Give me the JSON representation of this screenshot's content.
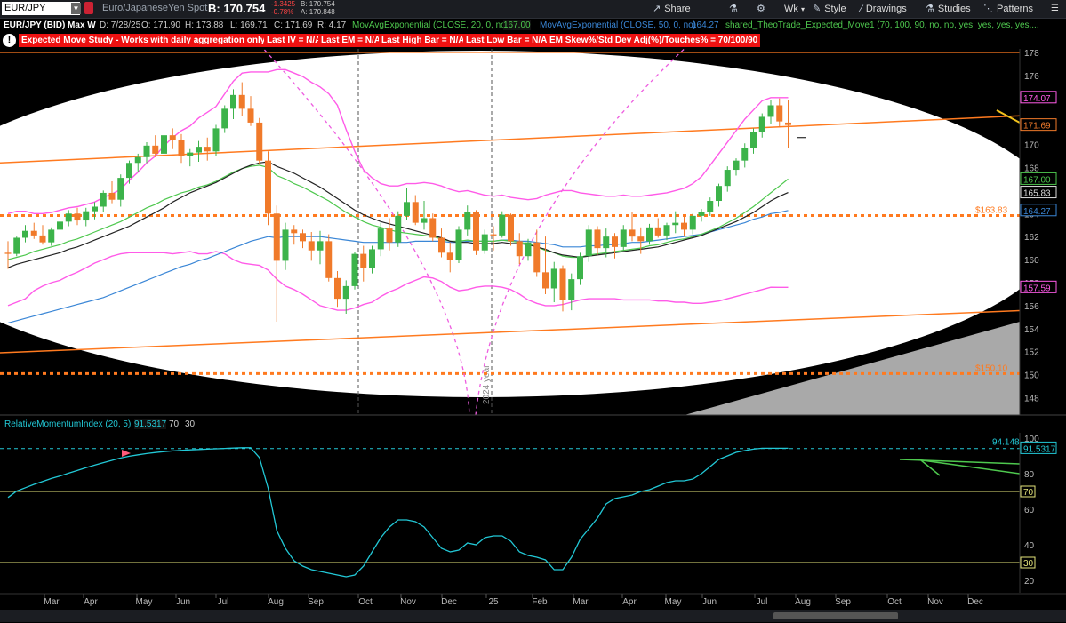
{
  "toolbar": {
    "symbol": "EUR/JPY",
    "description": "Euro/JapaneseYen Spot",
    "bid": "B: 170.754",
    "change": "-1.3425",
    "change_pct": "-0.78%",
    "bid_small": "B: 170.754",
    "ask_small": "A: 170.848",
    "share": "Share",
    "timeframe": "Wk",
    "style": "Style",
    "drawings": "Drawings",
    "studies": "Studies",
    "patterns": "Patterns"
  },
  "legend": {
    "title": "EUR/JPY (BID) Max W",
    "date": "D: 7/28/25",
    "open": "O: 171.90",
    "high": "H: 173.88",
    "low": "L: 169.71",
    "close": "C: 171.69",
    "range": "R: 4.17",
    "ema20": "MovAvgExponential (CLOSE, 20, 0, no)",
    "ema20_val": "167.00",
    "ema50": "MovAvgExponential (CLOSE, 50, 0, no)",
    "ema50_val": "164.27",
    "study": "shared_TheoTrade_Expected_Move1 (70, 100, 90, no, no, yes, yes, yes, yes,..."
  },
  "alerts": [
    "Expected Move Study - Works with daily aggregation only.",
    "Last IV = N/A",
    "Last EM = N/A",
    "Last High Bar = N/A",
    "Last Low Bar = N/A",
    "EM Skew%/Std Dev Adj(%)/Touches% = 70/100/90"
  ],
  "lower": {
    "title": "RelativeMomentumIndex (20, 5)",
    "value": "91.5317",
    "ob": "70",
    "os": "30",
    "max_label": "94.148"
  },
  "annotations": {
    "level_high": "$163.83",
    "level_low": "$150.10",
    "year_label": "2024 year"
  },
  "colors": {
    "bull": "#3cb34a",
    "bear": "#f07a2a",
    "bollinger": "#ff5be8",
    "ema20": "#4ec84e",
    "ema50": "#3a86d6",
    "sma": "#222222",
    "channel": "#ff7a1f",
    "rmi": "#22c8d6"
  },
  "chart_data": [
    {
      "type": "candlestick",
      "title": "EUR/JPY (BID) Max W",
      "ylim": [
        146.5,
        178.3
      ],
      "yticks": [
        148,
        150,
        152,
        154,
        156,
        158,
        160,
        162,
        164,
        166,
        168,
        170,
        172,
        174,
        176,
        178
      ],
      "months": [
        "Mar",
        "Apr",
        "May",
        "Jun",
        "Jul",
        "Aug",
        "Sep",
        "Oct",
        "Nov",
        "Dec",
        "25",
        "Feb",
        "Mar",
        "Apr",
        "May",
        "Jun",
        "Jul",
        "Aug",
        "Sep",
        "Oct",
        "Nov",
        "Dec"
      ],
      "price_labels": [
        {
          "text": "174.07",
          "value": 174.07,
          "color": "#ff5be8"
        },
        {
          "text": "171.69",
          "value": 171.69,
          "color": "#f07a2a"
        },
        {
          "text": "167.00",
          "value": 167.0,
          "color": "#4ec84e"
        },
        {
          "text": "165.83",
          "value": 165.83,
          "color": "#dddddd"
        },
        {
          "text": "164.27",
          "value": 164.27,
          "color": "#3a86d6"
        },
        {
          "text": "157.59",
          "value": 157.59,
          "color": "#ff5be8"
        }
      ],
      "levels": [
        163.83,
        150.1,
        178.0
      ],
      "candles": [
        [
          160.6,
          161.6,
          159.2,
          160.5
        ],
        [
          160.5,
          162.0,
          160.3,
          161.9
        ],
        [
          161.9,
          163.0,
          161.5,
          162.5
        ],
        [
          162.5,
          163.2,
          161.8,
          162.1
        ],
        [
          162.1,
          163.0,
          161.3,
          161.5
        ],
        [
          161.5,
          162.8,
          161.2,
          162.6
        ],
        [
          162.6,
          163.6,
          162.2,
          163.3
        ],
        [
          163.3,
          164.3,
          162.9,
          164.0
        ],
        [
          164.0,
          164.5,
          163.0,
          163.4
        ],
        [
          163.4,
          164.5,
          162.9,
          164.2
        ],
        [
          164.2,
          165.0,
          163.5,
          164.6
        ],
        [
          164.6,
          166.0,
          164.1,
          165.8
        ],
        [
          165.8,
          166.8,
          164.9,
          165.2
        ],
        [
          165.2,
          167.4,
          164.6,
          167.1
        ],
        [
          167.1,
          168.6,
          166.6,
          168.4
        ],
        [
          168.4,
          169.2,
          167.6,
          168.9
        ],
        [
          168.9,
          170.2,
          168.4,
          169.9
        ],
        [
          169.9,
          170.8,
          168.9,
          169.2
        ],
        [
          169.2,
          171.1,
          168.8,
          170.8
        ],
        [
          170.8,
          171.4,
          169.6,
          170.4
        ],
        [
          170.4,
          170.9,
          168.4,
          169.0
        ],
        [
          169.0,
          169.6,
          168.1,
          169.3
        ],
        [
          169.3,
          170.3,
          168.5,
          169.8
        ],
        [
          169.8,
          170.6,
          168.6,
          169.4
        ],
        [
          169.4,
          171.7,
          169.0,
          171.4
        ],
        [
          171.4,
          173.4,
          171.0,
          173.1
        ],
        [
          173.1,
          174.8,
          172.2,
          174.3
        ],
        [
          174.3,
          175.4,
          172.5,
          173.1
        ],
        [
          173.1,
          174.2,
          171.6,
          171.9
        ],
        [
          171.9,
          172.3,
          168.3,
          168.6
        ],
        [
          168.6,
          169.4,
          163.0,
          164.0
        ],
        [
          164.0,
          164.7,
          154.6,
          159.9
        ],
        [
          159.9,
          163.2,
          159.1,
          162.6
        ],
        [
          162.6,
          163.0,
          161.3,
          162.3
        ],
        [
          162.3,
          162.6,
          161.0,
          161.6
        ],
        [
          161.6,
          162.4,
          159.9,
          160.8
        ],
        [
          160.8,
          162.5,
          159.6,
          161.6
        ],
        [
          161.6,
          162.2,
          158.1,
          158.4
        ],
        [
          158.4,
          159.0,
          155.9,
          156.6
        ],
        [
          156.6,
          158.2,
          155.3,
          157.7
        ],
        [
          157.7,
          160.7,
          157.4,
          160.5
        ],
        [
          160.5,
          161.2,
          158.1,
          159.3
        ],
        [
          159.3,
          161.2,
          158.8,
          160.9
        ],
        [
          160.9,
          163.2,
          160.3,
          162.7
        ],
        [
          162.7,
          163.6,
          160.8,
          161.5
        ],
        [
          161.5,
          164.2,
          161.1,
          163.8
        ],
        [
          163.8,
          166.2,
          163.4,
          165.0
        ],
        [
          165.0,
          165.6,
          163.0,
          163.2
        ],
        [
          163.2,
          165.1,
          162.6,
          163.6
        ],
        [
          163.6,
          164.0,
          161.6,
          161.9
        ],
        [
          161.9,
          162.7,
          160.2,
          160.6
        ],
        [
          160.6,
          161.5,
          158.9,
          160.0
        ],
        [
          160.0,
          162.9,
          159.7,
          162.6
        ],
        [
          162.6,
          164.7,
          162.1,
          164.1
        ],
        [
          164.1,
          164.3,
          160.4,
          160.8
        ],
        [
          160.8,
          162.6,
          160.5,
          162.2
        ],
        [
          162.2,
          162.9,
          160.8,
          162.1
        ],
        [
          162.1,
          164.2,
          161.9,
          163.9
        ],
        [
          163.9,
          164.0,
          161.2,
          161.6
        ],
        [
          161.6,
          162.3,
          159.6,
          160.3
        ],
        [
          160.3,
          161.8,
          159.9,
          161.5
        ],
        [
          161.5,
          162.6,
          158.5,
          158.9
        ],
        [
          158.9,
          162.0,
          157.0,
          157.5
        ],
        [
          157.5,
          159.8,
          156.3,
          159.2
        ],
        [
          159.2,
          159.5,
          155.5,
          156.5
        ],
        [
          156.5,
          158.8,
          155.6,
          158.3
        ],
        [
          158.3,
          160.6,
          157.8,
          160.3
        ],
        [
          160.3,
          163.0,
          159.8,
          162.6
        ],
        [
          162.6,
          162.9,
          160.4,
          161.0
        ],
        [
          161.0,
          162.7,
          160.2,
          162.0
        ],
        [
          162.0,
          162.3,
          160.1,
          161.1
        ],
        [
          161.1,
          163.0,
          160.8,
          162.6
        ],
        [
          162.6,
          164.1,
          161.6,
          162.0
        ],
        [
          162.0,
          162.8,
          160.5,
          161.6
        ],
        [
          161.6,
          163.1,
          161.3,
          162.8
        ],
        [
          162.8,
          163.6,
          161.9,
          162.1
        ],
        [
          162.1,
          163.2,
          161.7,
          163.0
        ],
        [
          163.0,
          164.2,
          162.3,
          163.2
        ],
        [
          163.2,
          163.8,
          162.0,
          162.6
        ],
        [
          162.6,
          164.0,
          162.2,
          163.8
        ],
        [
          163.8,
          164.4,
          163.3,
          164.1
        ],
        [
          164.1,
          165.4,
          163.8,
          165.1
        ],
        [
          165.1,
          166.6,
          164.6,
          166.4
        ],
        [
          166.4,
          168.1,
          165.9,
          167.8
        ],
        [
          167.8,
          168.8,
          167.3,
          168.6
        ],
        [
          168.6,
          170.1,
          168.0,
          169.7
        ],
        [
          169.7,
          171.4,
          169.2,
          171.1
        ],
        [
          171.1,
          172.7,
          170.6,
          172.4
        ],
        [
          172.4,
          173.9,
          171.8,
          173.4
        ],
        [
          173.4,
          174.0,
          171.5,
          172.0
        ],
        [
          171.9,
          173.88,
          169.71,
          171.69
        ]
      ],
      "ema20": [
        160.0,
        160.2,
        160.4,
        160.7,
        160.9,
        161.1,
        161.3,
        161.6,
        161.8,
        162.1,
        162.4,
        162.7,
        163.0,
        163.3,
        163.7,
        164.1,
        164.5,
        164.8,
        165.2,
        165.5,
        165.8,
        166.0,
        166.3,
        166.5,
        166.8,
        167.2,
        167.6,
        167.9,
        168.1,
        168.2,
        168.0,
        167.3,
        167.0,
        166.6,
        166.3,
        165.9,
        165.5,
        165.1,
        164.6,
        164.1,
        163.7,
        163.3,
        163.0,
        162.8,
        162.6,
        162.4,
        162.3,
        162.2,
        162.1,
        162.0,
        161.8,
        161.6,
        161.6,
        161.7,
        161.6,
        161.6,
        161.6,
        161.7,
        161.6,
        161.5,
        161.4,
        161.1,
        160.8,
        160.6,
        160.3,
        160.2,
        160.2,
        160.4,
        160.5,
        160.6,
        160.7,
        160.8,
        160.9,
        161.0,
        161.2,
        161.3,
        161.5,
        161.7,
        161.8,
        162.0,
        162.2,
        162.5,
        162.8,
        163.2,
        163.6,
        164.1,
        164.6,
        165.2,
        165.8,
        166.4,
        167.0
      ],
      "ema50": [
        154.5,
        154.7,
        154.9,
        155.1,
        155.3,
        155.5,
        155.7,
        155.9,
        156.1,
        156.3,
        156.5,
        156.7,
        157.0,
        157.3,
        157.6,
        157.9,
        158.2,
        158.5,
        158.8,
        159.1,
        159.4,
        159.6,
        159.9,
        160.1,
        160.4,
        160.7,
        161.0,
        161.3,
        161.6,
        161.8,
        162.0,
        161.9,
        162.0,
        162.0,
        162.0,
        162.0,
        162.0,
        161.9,
        161.8,
        161.7,
        161.6,
        161.5,
        161.5,
        161.5,
        161.5,
        161.5,
        161.5,
        161.6,
        161.6,
        161.6,
        161.6,
        161.5,
        161.5,
        161.6,
        161.6,
        161.6,
        161.6,
        161.7,
        161.7,
        161.6,
        161.6,
        161.5,
        161.4,
        161.3,
        161.1,
        161.1,
        161.1,
        161.2,
        161.2,
        161.3,
        161.3,
        161.4,
        161.5,
        161.5,
        161.6,
        161.7,
        161.8,
        161.9,
        162.0,
        162.1,
        162.2,
        162.4,
        162.6,
        162.8,
        163.0,
        163.2,
        163.5,
        163.7,
        164.0,
        164.1,
        164.27
      ],
      "sma": [
        159.3,
        159.6,
        159.8,
        160.0,
        160.2,
        160.4,
        160.6,
        160.9,
        161.1,
        161.4,
        161.7,
        162.0,
        162.3,
        162.6,
        162.9,
        163.3,
        163.7,
        164.1,
        164.5,
        165.0,
        165.4,
        165.8,
        166.1,
        166.4,
        166.7,
        167.1,
        167.5,
        167.9,
        168.2,
        168.4,
        168.5,
        168.1,
        167.8,
        167.5,
        167.1,
        166.7,
        166.3,
        165.8,
        165.3,
        164.8,
        164.3,
        163.9,
        163.6,
        163.3,
        163.1,
        162.9,
        162.7,
        162.5,
        162.3,
        162.1,
        161.9,
        161.6,
        161.5,
        161.5,
        161.4,
        161.4,
        161.4,
        161.5,
        161.4,
        161.4,
        161.3,
        161.1,
        160.9,
        160.6,
        160.4,
        160.3,
        160.2,
        160.3,
        160.4,
        160.5,
        160.6,
        160.7,
        160.8,
        160.9,
        161.0,
        161.1,
        161.3,
        161.5,
        161.7,
        161.9,
        162.1,
        162.4,
        162.7,
        163.0,
        163.3,
        163.7,
        164.1,
        164.6,
        165.1,
        165.5,
        165.83
      ],
      "bb_upper": [
        164.0,
        164.2,
        164.2,
        164.0,
        164.0,
        164.1,
        164.3,
        164.5,
        164.6,
        164.8,
        165.0,
        165.4,
        165.7,
        166.1,
        166.9,
        167.6,
        168.4,
        169.0,
        169.9,
        170.6,
        171.2,
        171.6,
        172.3,
        172.8,
        173.3,
        174.4,
        175.5,
        176.2,
        176.3,
        176.3,
        176.3,
        176.5,
        176.5,
        176.2,
        175.9,
        175.4,
        175.0,
        174.4,
        173.4,
        171.3,
        169.4,
        167.8,
        167.1,
        166.6,
        166.4,
        166.4,
        166.6,
        166.6,
        166.7,
        166.6,
        166.4,
        166.1,
        165.9,
        166.0,
        165.8,
        165.6,
        165.5,
        165.6,
        165.4,
        165.3,
        165.2,
        165.3,
        165.6,
        165.8,
        166.0,
        166.0,
        165.8,
        165.7,
        165.6,
        165.5,
        165.5,
        165.6,
        165.5,
        165.5,
        165.6,
        165.7,
        165.8,
        166.0,
        166.2,
        166.6,
        167.2,
        168.2,
        169.2,
        170.2,
        171.2,
        172.2,
        173.0,
        173.8,
        174.07,
        174.07,
        174.07
      ],
      "bb_lower": [
        156.0,
        156.3,
        156.6,
        157.3,
        157.7,
        158.0,
        158.2,
        158.6,
        158.9,
        159.3,
        159.7,
        160.0,
        160.3,
        160.5,
        160.6,
        160.6,
        160.6,
        160.6,
        160.6,
        160.5,
        160.6,
        160.7,
        160.5,
        160.5,
        160.7,
        160.5,
        160.0,
        159.7,
        159.6,
        159.5,
        159.1,
        158.3,
        157.7,
        157.4,
        157.0,
        156.5,
        156.0,
        155.8,
        155.6,
        155.6,
        155.8,
        156.1,
        156.3,
        156.8,
        157.2,
        157.5,
        157.9,
        158.2,
        158.5,
        158.4,
        158.1,
        157.6,
        157.3,
        157.4,
        157.6,
        157.7,
        157.7,
        157.6,
        157.4,
        157.0,
        156.5,
        156.2,
        156.0,
        156.0,
        156.1,
        156.3,
        156.5,
        156.6,
        156.6,
        156.6,
        156.6,
        156.5,
        156.5,
        156.5,
        156.5,
        156.4,
        156.4,
        156.3,
        156.3,
        156.2,
        156.2,
        156.3,
        156.4,
        156.6,
        156.8,
        157.0,
        157.2,
        157.4,
        157.6,
        157.59,
        157.59
      ],
      "channel_upper": [
        [
          0,
          168.4
        ],
        [
          140,
          173.3
        ]
      ],
      "channel_lower": [
        [
          0,
          151.9
        ],
        [
          140,
          156.3
        ]
      ]
    },
    {
      "type": "line",
      "title": "RelativeMomentumIndex (20, 5)",
      "ylim": [
        13,
        103
      ],
      "yticks": [
        20,
        40,
        60,
        80,
        100
      ],
      "hlines": [
        70,
        30,
        94.148
      ],
      "values": [
        66.6,
        70.2,
        72.1,
        74.0,
        75.6,
        77.3,
        78.7,
        80.3,
        81.8,
        83.4,
        84.8,
        86.2,
        87.5,
        88.8,
        89.8,
        90.6,
        91.3,
        91.9,
        92.4,
        92.8,
        93.1,
        93.4,
        93.6,
        93.8,
        94.0,
        94.2,
        94.4,
        94.6,
        94.6,
        89.0,
        72.0,
        48.0,
        38.0,
        31.0,
        28.0,
        26.0,
        25.0,
        24.0,
        23.0,
        22.0,
        23.0,
        28.0,
        36.0,
        44.0,
        50.0,
        54.0,
        54.0,
        53.0,
        50.0,
        44.0,
        38.0,
        36.0,
        37.0,
        41.0,
        40.0,
        44.0,
        45.0,
        45.0,
        42.0,
        36.0,
        34.0,
        33.0,
        31.5,
        26.0,
        26.0,
        33.0,
        43.0,
        49.0,
        55.0,
        63.0,
        66.0,
        67.0,
        68.0,
        70.0,
        71.0,
        73.0,
        75.0,
        76.0,
        76.0,
        77.0,
        80.0,
        84.0,
        88.0,
        90.0,
        92.0,
        93.0,
        93.8,
        94.3,
        94.3,
        94.3,
        94.3
      ]
    }
  ]
}
